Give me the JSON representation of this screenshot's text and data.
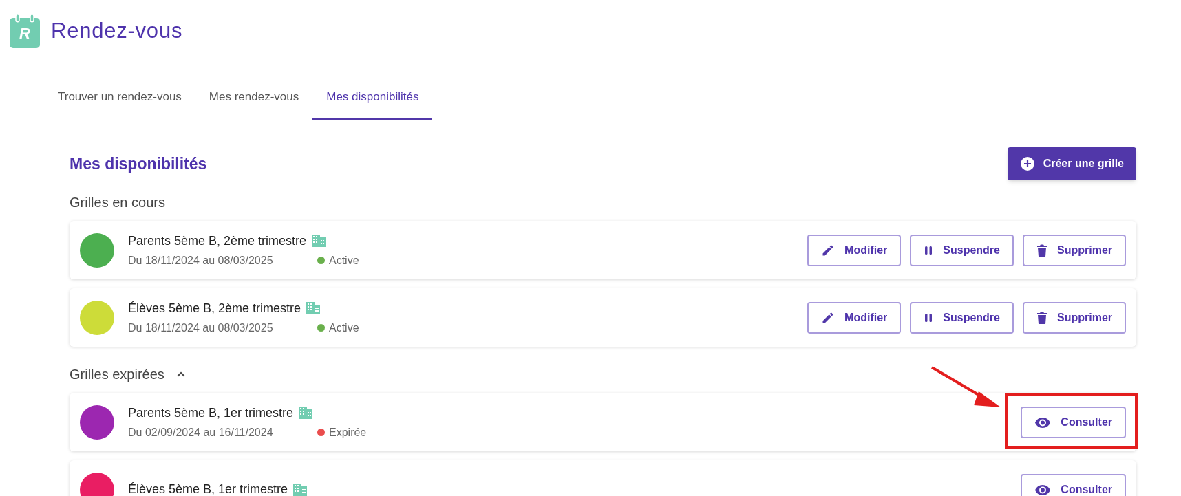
{
  "app": {
    "title": "Rendez-vous",
    "logo_letter": "R"
  },
  "tabs": [
    {
      "label": "Trouver un rendez-vous",
      "selected": false
    },
    {
      "label": "Mes rendez-vous",
      "selected": false
    },
    {
      "label": "Mes disponibilités",
      "selected": true
    }
  ],
  "page": {
    "heading": "Mes disponibilités",
    "create_button": "Créer une grille"
  },
  "sections": [
    {
      "title": "Grilles en cours",
      "grids": [
        {
          "name": "Parents 5ème B, 2ème trimestre",
          "color": "#4caf50",
          "dates": "Du 18/11/2024 au 08/03/2025",
          "status": {
            "kind": "active",
            "label": "Active"
          },
          "actions": [
            {
              "kind": "edit",
              "label": "Modifier"
            },
            {
              "kind": "pause",
              "label": "Suspendre"
            },
            {
              "kind": "delete",
              "label": "Supprimer"
            }
          ]
        },
        {
          "name": "Élèves 5ème B, 2ème trimestre",
          "color": "#cddc39",
          "dates": "Du 18/11/2024 au 08/03/2025",
          "status": {
            "kind": "active",
            "label": "Active"
          },
          "actions": [
            {
              "kind": "edit",
              "label": "Modifier"
            },
            {
              "kind": "pause",
              "label": "Suspendre"
            },
            {
              "kind": "delete",
              "label": "Supprimer"
            }
          ]
        }
      ]
    },
    {
      "title": "Grilles expirées",
      "expanded": true,
      "grids": [
        {
          "name": "Parents 5ème B, 1er trimestre",
          "color": "#9c27b0",
          "dates": "Du 02/09/2024 au 16/11/2024",
          "status": {
            "kind": "expired",
            "label": "Expirée"
          },
          "highlighted": true,
          "actions": [
            {
              "kind": "view",
              "label": "Consulter"
            }
          ]
        },
        {
          "name": "Élèves 5ème B, 1er trimestre",
          "color": "#e91e63",
          "actions": [
            {
              "kind": "view",
              "label": "Consulter"
            }
          ]
        }
      ]
    }
  ]
}
